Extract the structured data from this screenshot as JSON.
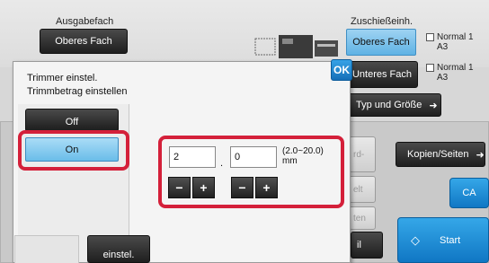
{
  "header": {
    "output_tray_label": "Ausgabefach",
    "output_tray_value": "Oberes Fach",
    "feed_label": "Zuschießeinh.",
    "feed_trays": [
      {
        "label": "Oberes Fach",
        "paper": "Normal 1",
        "size": "A3",
        "selected": true
      },
      {
        "label": "Unteres Fach",
        "paper": "Normal 1",
        "size": "A3",
        "selected": false
      }
    ],
    "type_size_label": "Typ und Größe"
  },
  "background": {
    "copies_pages_label": "Kopien/Seiten",
    "ca_label": "CA",
    "start_label": "Start",
    "bottom_button_label": "einstel.",
    "faded_buttons": [
      "rd-",
      "ten",
      "elt",
      "en",
      "ten"
    ],
    "partial_label": "il"
  },
  "dialog": {
    "title_line1": "Trimmer einstel.",
    "title_line2": "Trimmbetrag einstellen",
    "ok_label": "OK",
    "off_label": "Off",
    "on_label": "On",
    "value1": "2",
    "separator": ".",
    "value2": "0",
    "range": "(2.0~20.0)",
    "unit": "mm",
    "minus": "−",
    "plus": "+"
  },
  "colors": {
    "accent_blue": "#5fb2e4",
    "highlight_red": "#d4203a",
    "dark_button": "#1f1f1f"
  }
}
